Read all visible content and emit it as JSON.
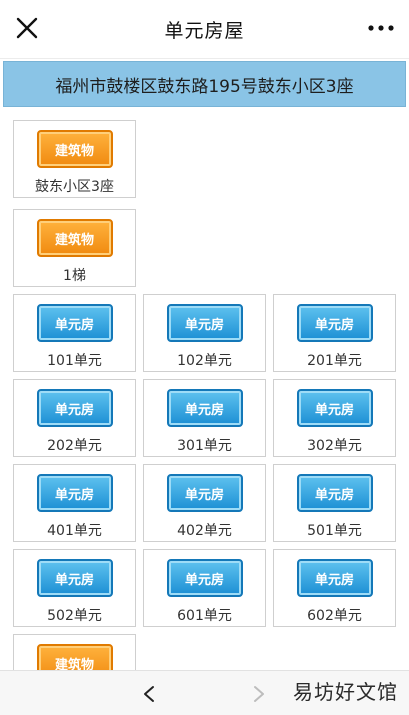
{
  "header": {
    "title": "单元房屋",
    "close_icon": "close-icon",
    "more_icon": "more-icon"
  },
  "address": "福州市鼓楼区鼓东路195号鼓东小区3座",
  "colors": {
    "address_bg": "#8ac4e6",
    "building_badge": "#f08a10",
    "unit_badge": "#1c8fd4"
  },
  "cards": [
    {
      "badge": "建筑物",
      "label": "鼓东小区3座",
      "type": "building"
    },
    {
      "badge": "建筑物",
      "label": "1梯",
      "type": "building"
    },
    {
      "badge": "单元房",
      "label": "101单元",
      "type": "unit"
    },
    {
      "badge": "单元房",
      "label": "102单元",
      "type": "unit"
    },
    {
      "badge": "单元房",
      "label": "201单元",
      "type": "unit"
    },
    {
      "badge": "单元房",
      "label": "202单元",
      "type": "unit"
    },
    {
      "badge": "单元房",
      "label": "301单元",
      "type": "unit"
    },
    {
      "badge": "单元房",
      "label": "302单元",
      "type": "unit"
    },
    {
      "badge": "单元房",
      "label": "401单元",
      "type": "unit"
    },
    {
      "badge": "单元房",
      "label": "402单元",
      "type": "unit"
    },
    {
      "badge": "单元房",
      "label": "501单元",
      "type": "unit"
    },
    {
      "badge": "单元房",
      "label": "502单元",
      "type": "unit"
    },
    {
      "badge": "单元房",
      "label": "601单元",
      "type": "unit"
    },
    {
      "badge": "单元房",
      "label": "602单元",
      "type": "unit"
    },
    {
      "badge": "建筑物",
      "label": "",
      "type": "building"
    }
  ],
  "nav": {
    "back_icon": "chevron-left-icon",
    "forward_icon": "chevron-right-icon"
  },
  "watermark": "易坊好文馆"
}
